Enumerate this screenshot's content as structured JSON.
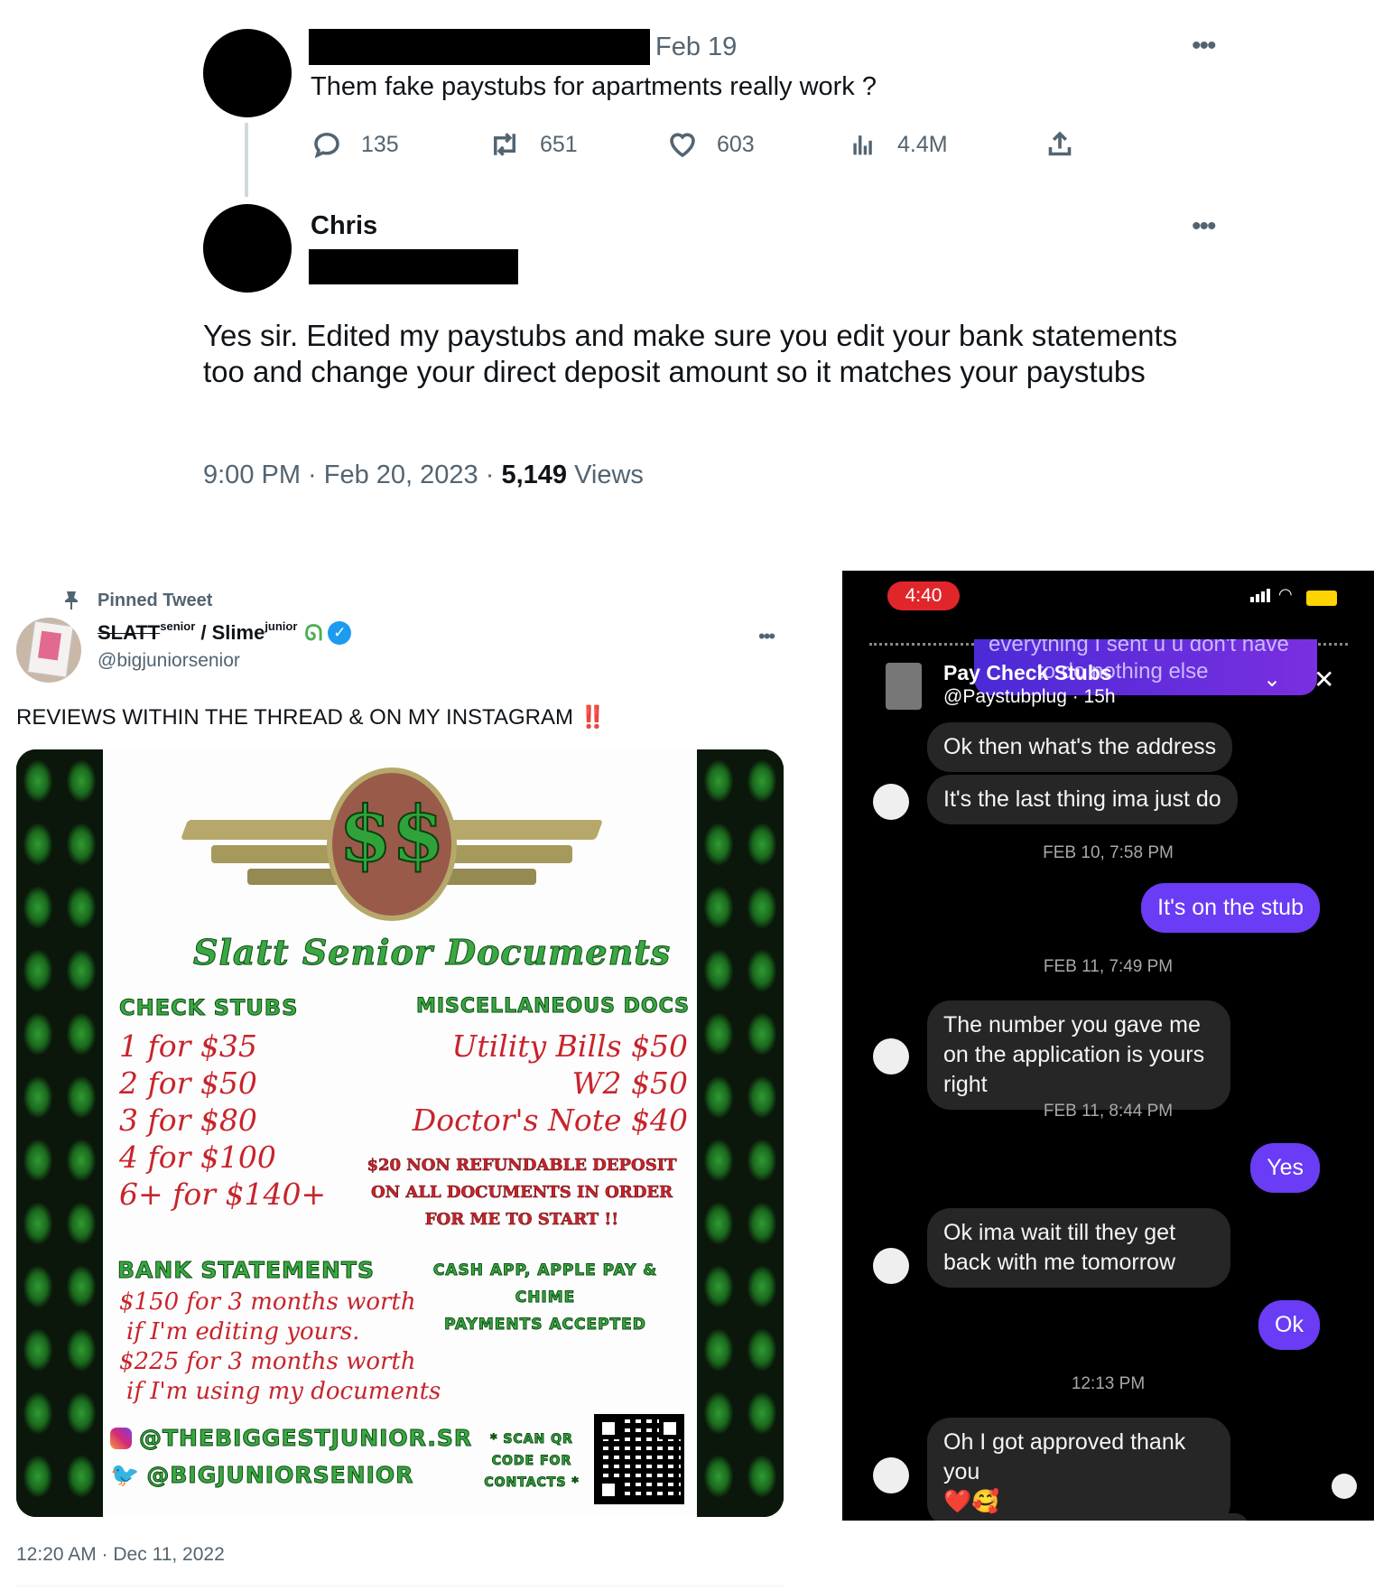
{
  "top_tweet": {
    "date": "Feb 19",
    "text": "Them fake paystubs for apartments really work ?",
    "replies": "135",
    "retweets": "651",
    "likes": "603",
    "views": "4.4M"
  },
  "reply_tweet": {
    "name": "Chris",
    "text": "Yes sir. Edited my paystubs and make sure you edit your bank statements too and change your direct deposit amount so it matches your paystubs",
    "time": "9:00 PM · Feb 20, 2023 · ",
    "views_count": "5,149",
    "views_label": " Views"
  },
  "pinned_tweet": {
    "pinned_label": "Pinned Tweet",
    "name": "SLATT",
    "name_sup1": "senior",
    "name_sep": " / Slime",
    "name_sup2": "junior",
    "handle": "@bigjuniorsenior",
    "text": "REVIEWS WITHIN THE THREAD & ON MY INSTAGRAM",
    "emphasis": "‼️",
    "time": "12:20 AM · Dec 11, 2022",
    "flyer": {
      "title": "Slatt Senior Documents",
      "logo_text": "$$",
      "check_stubs_title": "CHECK STUBS",
      "check_stubs": [
        "1 for $35",
        "2 for $50",
        "3 for $80",
        "4 for $100",
        "6+ for $140+"
      ],
      "misc_title": "MISCELLANEOUS DOCS",
      "misc": [
        "Utility Bills $50",
        "W2 $50",
        "Doctor's Note $40"
      ],
      "deposit_note": [
        "$20 NON REFUNDABLE DEPOSIT",
        "ON ALL DOCUMENTS IN ORDER",
        "FOR ME TO START !!"
      ],
      "bank_title": "BANK STATEMENTS",
      "bank": [
        "$150 for 3 months worth",
        "if I'm editing yours.",
        "$225 for 3 months worth",
        "if I'm using my documents"
      ],
      "payments": [
        "CASH APP, APPLE PAY & CHIME",
        "PAYMENTS ACCEPTED"
      ],
      "instagram": "@THEBIGGESTJUNIOR.SR",
      "twitter": "@BIGJUNIORSENIOR",
      "scan": [
        "* SCAN QR",
        "CODE FOR",
        "CONTACTS *"
      ]
    }
  },
  "chat": {
    "status_time": "4:40",
    "overlay_text_1": "everything I sent u u don't have",
    "overlay_text_2": "to do nothing else",
    "contact_name": "Pay Check Stubs",
    "contact_handle": "@Paystubplug · 15h",
    "messages": [
      {
        "dir": "in",
        "text": "Ok then what's the address"
      },
      {
        "dir": "in",
        "text": "It's the last thing ima just do"
      },
      {
        "dir": "ts",
        "text": "FEB 10, 7:58 PM"
      },
      {
        "dir": "out",
        "text": "It's on the stub"
      },
      {
        "dir": "ts",
        "text": "FEB 11, 7:49 PM"
      },
      {
        "dir": "in",
        "text": "The number you gave me on the application is yours right"
      },
      {
        "dir": "ts",
        "text": "FEB 11, 8:44 PM"
      },
      {
        "dir": "out",
        "text": "Yes"
      },
      {
        "dir": "in",
        "text": "Ok ima wait till they get back with me tomorrow"
      },
      {
        "dir": "out",
        "text": "Ok"
      },
      {
        "dir": "ts",
        "text": "12:13 PM"
      },
      {
        "dir": "in",
        "text": "Oh I got approved thank you"
      },
      {
        "dir": "in",
        "text": "❤️🥰"
      }
    ],
    "colors": {
      "incoming": "#262626",
      "outgoing": "#6a3cf5",
      "background": "#000000",
      "time_badge": "#e0262a"
    }
  }
}
